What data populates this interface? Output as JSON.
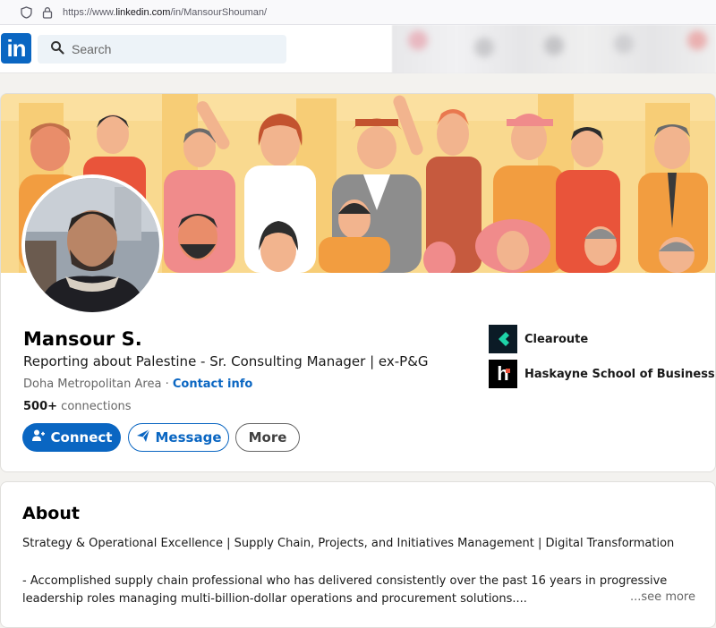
{
  "browser": {
    "url_prefix": "https://www.",
    "url_domain": "linkedin.com",
    "url_path": "/in/MansourShouman/"
  },
  "header": {
    "logo_text": "in",
    "search_placeholder": "Search"
  },
  "profile": {
    "name": "Mansour S.",
    "headline": "Reporting about Palestine - Sr. Consulting Manager | ex-P&G",
    "location": "Doha Metropolitan Area",
    "separator": "·",
    "contact_info": "Contact info",
    "connections_count": "500+",
    "connections_label": "connections",
    "buttons": {
      "connect": "Connect",
      "message": "Message",
      "more": "More"
    },
    "organizations": [
      {
        "name": "Clearoute",
        "logo_letter": ""
      },
      {
        "name": "Haskayne School of Business",
        "logo_letter": "h"
      }
    ]
  },
  "about": {
    "title": "About",
    "line1": "Strategy & Operational Excellence | Supply Chain, Projects, and Initiatives Management | Digital Transformation",
    "line2": "- Accomplished supply chain professional who has delivered consistently over the past 16 years in progressive leadership roles managing multi-billion-dollar operations and procurement solutions....",
    "see_more": "...see more"
  },
  "colors": {
    "brand_blue": "#0a66c2",
    "banner_bg": "#f9d98f",
    "page_bg": "#f3f2ef",
    "clearoute_teal": "#1ed4a8"
  },
  "icons": {
    "shield": "shield-icon",
    "lock": "lock-icon",
    "search": "search-icon",
    "connect": "add-person-icon",
    "message": "send-icon"
  }
}
